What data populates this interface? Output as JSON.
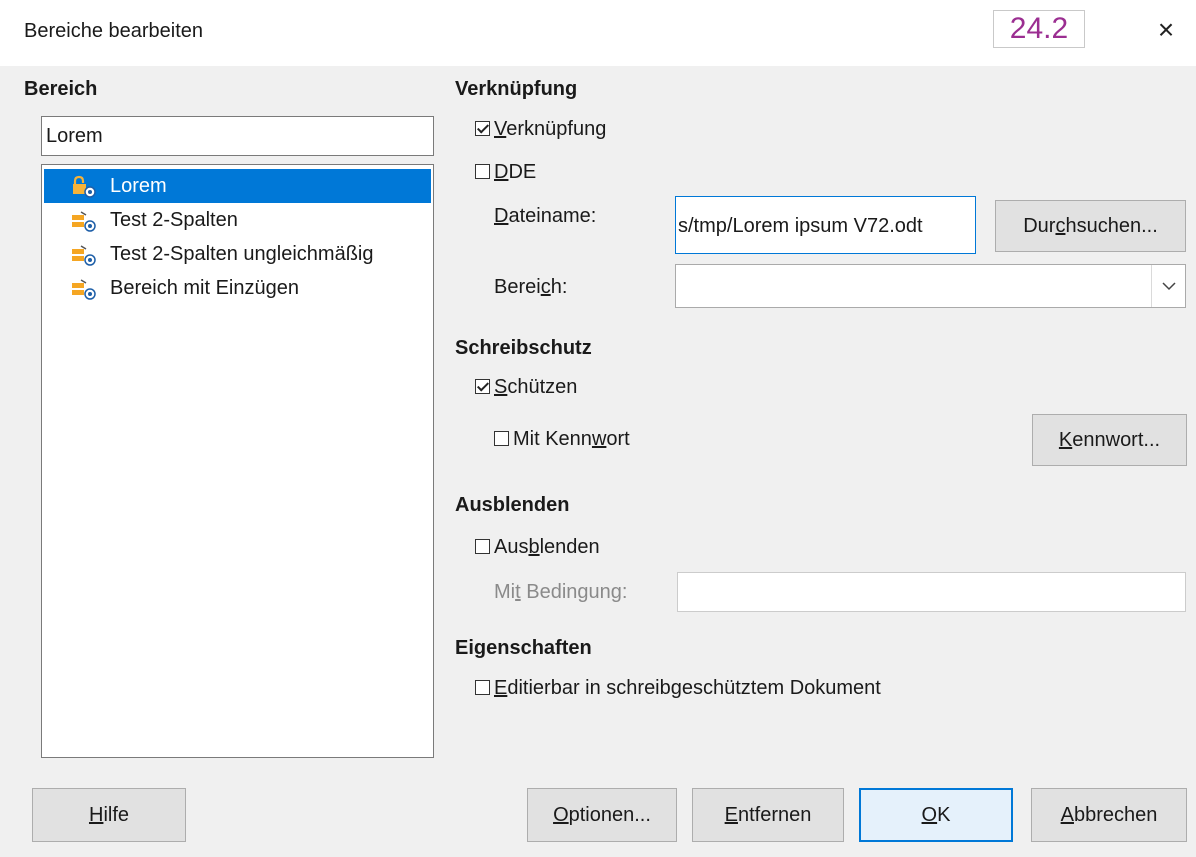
{
  "window": {
    "title": "Bereiche bearbeiten",
    "version": "24.2",
    "close_glyph": "×"
  },
  "bereich": {
    "heading": "Bereich",
    "name_value": "Lorem",
    "items": [
      {
        "label": "Lorem",
        "selected": true,
        "icon": "protected-section-icon"
      },
      {
        "label": "Test 2-Spalten",
        "selected": false,
        "icon": "linked-section-icon"
      },
      {
        "label": "Test 2-Spalten ungleichmäßig",
        "selected": false,
        "icon": "linked-section-icon"
      },
      {
        "label": "Bereich mit Einzügen",
        "selected": false,
        "icon": "linked-section-icon"
      }
    ]
  },
  "link": {
    "heading": "Verknüpfung",
    "link_checkbox": {
      "pre": "",
      "ul": "V",
      "post": "erknüpfung",
      "checked": true
    },
    "dde_checkbox": {
      "pre": "",
      "ul": "D",
      "post": "DE",
      "checked": false
    },
    "filename_label": {
      "pre": "",
      "ul": "D",
      "post": "ateiname:"
    },
    "filename_value": "s/tmp/Lorem ipsum V72.odt",
    "browse_button": {
      "pre": "Dur",
      "ul": "c",
      "post": "hsuchen..."
    },
    "section_label": {
      "pre": "Berei",
      "ul": "c",
      "post": "h:"
    },
    "section_value": ""
  },
  "protect": {
    "heading": "Schreibschutz",
    "protect_checkbox": {
      "pre": "",
      "ul": "S",
      "post": "chützen",
      "checked": true
    },
    "password_checkbox": {
      "pre": "Mit Kenn",
      "ul": "w",
      "post": "ort",
      "checked": false
    },
    "password_button": {
      "pre": "",
      "ul": "K",
      "post": "ennwort..."
    }
  },
  "hide": {
    "heading": "Ausblenden",
    "hide_checkbox": {
      "pre": "Aus",
      "ul": "b",
      "post": "lenden",
      "checked": false
    },
    "condition_label": {
      "pre": "Mi",
      "ul": "t",
      "post": " Bedingung:"
    },
    "condition_value": ""
  },
  "props": {
    "heading": "Eigenschaften",
    "editable_checkbox": {
      "pre": "",
      "ul": "E",
      "post": "ditierbar in schreibgeschütztem Dokument",
      "checked": false
    }
  },
  "buttons": {
    "help": {
      "pre": "",
      "ul": "H",
      "post": "ilfe"
    },
    "options": {
      "pre": "",
      "ul": "O",
      "post": "ptionen..."
    },
    "remove": {
      "pre": "",
      "ul": "E",
      "post": "ntfernen"
    },
    "ok": {
      "pre": "",
      "ul": "O",
      "post": "K"
    },
    "cancel": {
      "pre": "",
      "ul": "A",
      "post": "bbrechen"
    }
  },
  "colors": {
    "selection": "#0078d7",
    "version_text": "#9b2e91",
    "background": "#f0f0f0"
  }
}
